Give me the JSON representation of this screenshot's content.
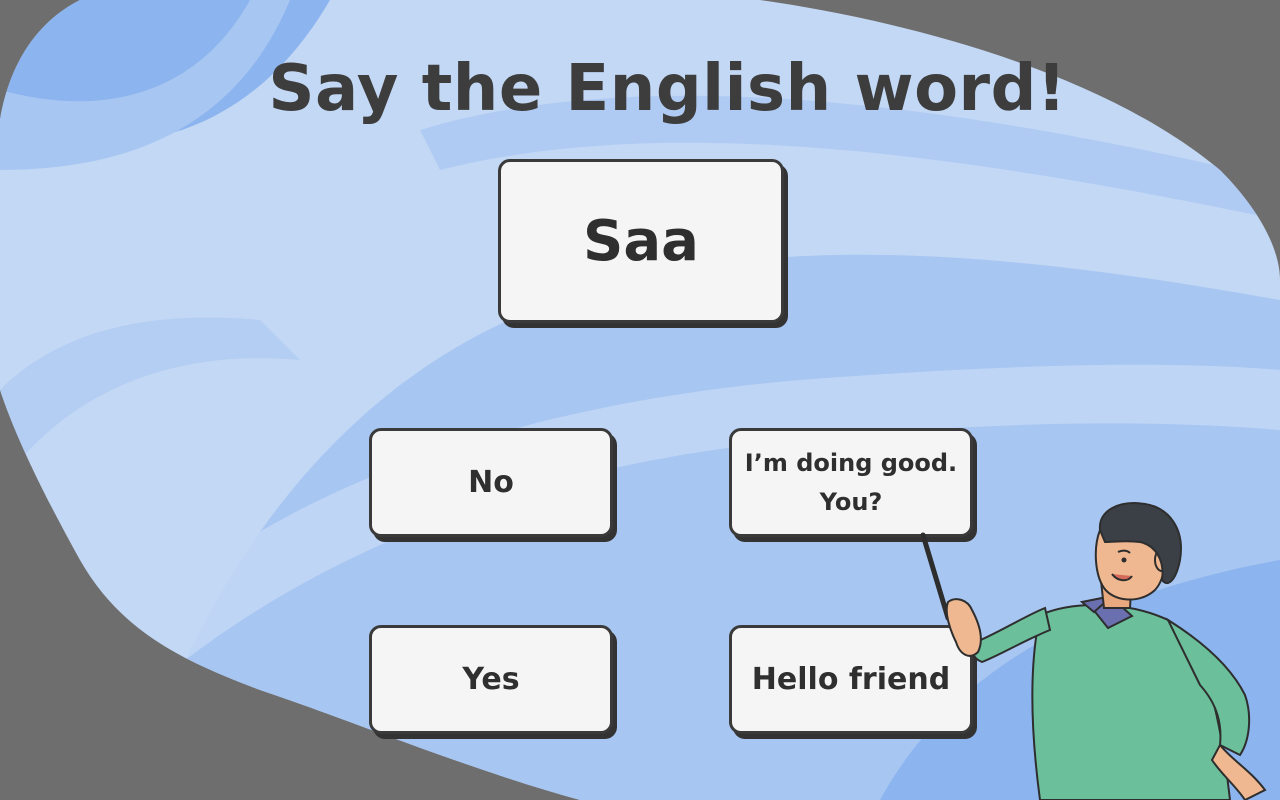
{
  "game": {
    "title": "Say the English word!",
    "prompt_word": "Saa",
    "options": [
      "No",
      "I’m doing good. You?",
      "Yes",
      "Hello friend"
    ]
  },
  "colors": {
    "frame": "#6e6e6e",
    "blob_light": "#c3d8f5",
    "blob_mid": "#a8c6f2",
    "blob_dark": "#8cb4ee",
    "card_bg": "#f5f5f5",
    "card_border": "#3a3a3a",
    "text": "#3d3d3d",
    "shirt": "#6bbf9b"
  },
  "icons": {
    "teacher": "teacher-pointing-illustration"
  }
}
